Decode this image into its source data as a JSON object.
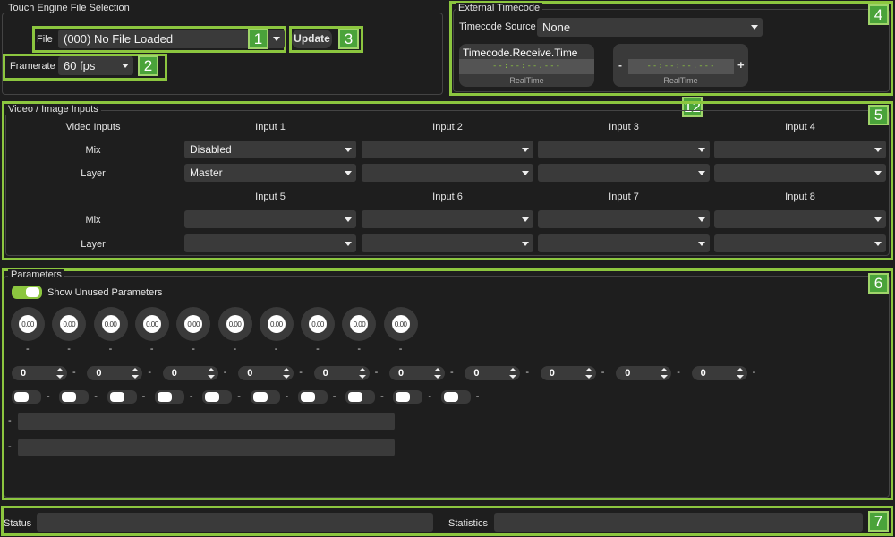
{
  "file_selection": {
    "title": "Touch Engine File Selection",
    "file_label": "File",
    "file_value": "(000) No File Loaded",
    "update_label": "Update",
    "framerate_label": "Framerate",
    "framerate_value": "60 fps"
  },
  "timecode": {
    "title": "External Timecode",
    "source_label": "Timecode Source",
    "source_value": "None",
    "receive_title": "Timecode.Receive.Time",
    "receive_value": "--:--:--.---",
    "receive_sub": "RealTime",
    "offset_minus": "-",
    "offset_value": "--:--:--.---",
    "offset_plus": "+",
    "offset_sub": "RealTime"
  },
  "video": {
    "title": "Video / Image Inputs",
    "col_header": "Video Inputs",
    "inputs_top": [
      "Input 1",
      "Input 2",
      "Input 3",
      "Input 4"
    ],
    "inputs_bottom": [
      "Input 5",
      "Input 6",
      "Input 7",
      "Input 8"
    ],
    "mix_label": "Mix",
    "layer_label": "Layer",
    "mix_top": [
      "Disabled",
      "",
      "",
      ""
    ],
    "layer_top": [
      "Master",
      "",
      "",
      ""
    ],
    "mix_bottom": [
      "",
      "",
      "",
      ""
    ],
    "layer_bottom": [
      "",
      "",
      "",
      ""
    ]
  },
  "parameters": {
    "title": "Parameters",
    "toggle_label": "Show Unused Parameters",
    "toggle_on": true,
    "knobs": [
      "0.00",
      "0.00",
      "0.00",
      "0.00",
      "0.00",
      "0.00",
      "0.00",
      "0.00",
      "0.00",
      "0.00"
    ],
    "knob_label": "-",
    "spinners": [
      "0",
      "0",
      "0",
      "0",
      "0",
      "0",
      "0",
      "0",
      "0",
      "0"
    ],
    "dash": "-"
  },
  "status": {
    "status_label": "Status",
    "statistics_label": "Statistics"
  },
  "badges": [
    "1",
    "2",
    "3",
    "4",
    "5",
    "6",
    "7",
    "12"
  ],
  "colors": {
    "accent": "#8cc63f",
    "badge": "#4aa33a",
    "background": "#1e1e1e",
    "control": "#3a3a3a"
  }
}
